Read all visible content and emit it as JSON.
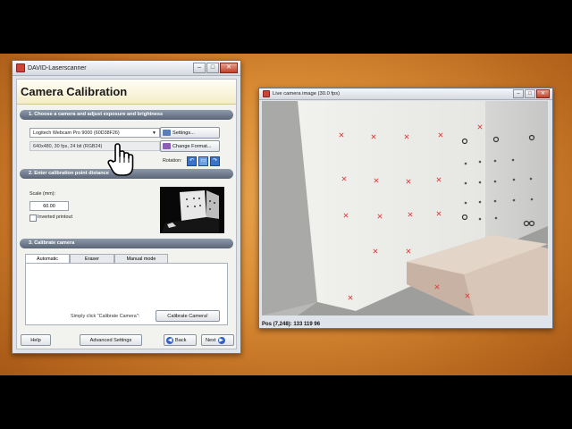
{
  "main_window": {
    "title": "DAVID-Laserscanner",
    "header": "Camera Calibration",
    "section1": {
      "title": "1. Choose a camera and adjust exposure and brightness",
      "camera_selected": "Logitech Webcam Pro 9000 (60D38F26)",
      "format_text": "640x480, 30 fps, 24 bit (RGB24)",
      "settings_label": "Settings...",
      "change_format_label": "Change Format...",
      "rotation_label": "Rotation:"
    },
    "section2": {
      "title": "2. Enter calibration point distance",
      "scale_label": "Scale (mm):",
      "scale_value": "60.00",
      "inverted_label": "Inverted printout"
    },
    "section3": {
      "title": "3. Calibrate camera",
      "tabs": [
        "Automatic",
        "Eraser",
        "Manual mode"
      ],
      "hint": "Simply click \"Calibrate Camera\":",
      "calibrate_label": "Calibrate Camera!"
    },
    "footer": {
      "help_label": "Help",
      "advanced_label": "Advanced Settings",
      "back_label": "Back",
      "next_label": "Next"
    }
  },
  "camera_window": {
    "title": "Live camera image (30.0 fps)",
    "status": "Pos (7,248): 133 119 96"
  },
  "colors": {
    "background": "#d98a33",
    "section_bar": "#6b7789",
    "header_bg": "#f7f0d0",
    "marker": "#e0413f"
  }
}
